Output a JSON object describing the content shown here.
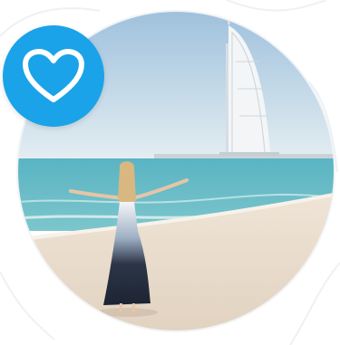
{
  "badge": {
    "icon": "heart-outline-icon",
    "color": "#1aa3e8"
  },
  "photo": {
    "subject": "beach-scene"
  },
  "colors": {
    "sky_top": "#a9c9e2",
    "sky_bottom": "#e3edf1",
    "sea": "#5fb7c4",
    "sand": "#eadccb",
    "dress_dark": "#2a3446"
  }
}
